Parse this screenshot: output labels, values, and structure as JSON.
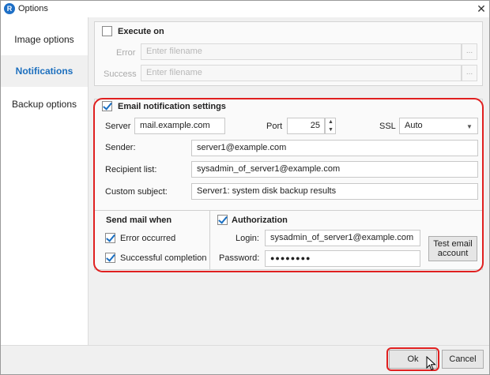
{
  "window": {
    "title": "Options",
    "icon": "app-logo-icon",
    "close_glyph": "✕"
  },
  "sidebar": {
    "items": [
      {
        "label": "Image options",
        "active": false
      },
      {
        "label": "Notifications",
        "active": true
      },
      {
        "label": "Backup options",
        "active": false
      }
    ]
  },
  "execute": {
    "label": "Execute on",
    "checked": false,
    "error_label": "Error",
    "error_placeholder": "Enter filename",
    "success_label": "Success",
    "success_placeholder": "Enter filename",
    "browse": "..."
  },
  "email": {
    "label": "Email notification settings",
    "checked": true,
    "server_label": "Server",
    "server_value": "mail.example.com",
    "port_label": "Port",
    "port_value": "25",
    "ssl_label": "SSL",
    "ssl_value": "Auto",
    "sender_label": "Sender:",
    "sender_value": "server1@example.com",
    "recipient_label": "Recipient list:",
    "recipient_value": "sysadmin_of_server1@example.com",
    "subject_label": "Custom subject:",
    "subject_value": "Server1: system disk backup results"
  },
  "send_when": {
    "title": "Send mail when",
    "error_label": "Error occurred",
    "error_checked": true,
    "success_label": "Successful completion",
    "success_checked": true
  },
  "auth": {
    "label": "Authorization",
    "checked": true,
    "login_label": "Login:",
    "login_value": "sysadmin_of_server1@example.com",
    "password_label": "Password:",
    "password_value": "●●●●●●●●",
    "test_button": "Test email account"
  },
  "footer": {
    "ok": "Ok",
    "cancel": "Cancel"
  },
  "colors": {
    "accent": "#1c6fbe",
    "highlight": "#e02020"
  }
}
